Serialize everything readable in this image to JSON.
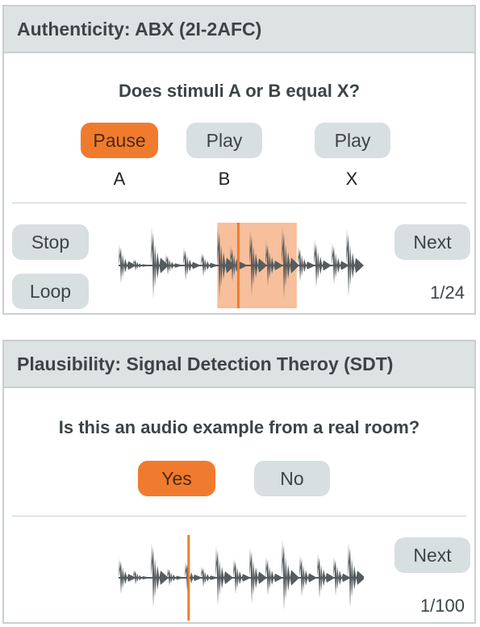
{
  "abx": {
    "title": "Authenticity: ABX (2I-2AFC)",
    "question": "Does stimuli A or B equal X?",
    "stimuli": [
      {
        "button_label": "Pause",
        "stimulus_label": "A",
        "active": true
      },
      {
        "button_label": "Play",
        "stimulus_label": "B",
        "active": false
      },
      {
        "button_label": "Play",
        "stimulus_label": "X",
        "active": false
      }
    ],
    "stop_label": "Stop",
    "loop_label": "Loop",
    "next_label": "Next",
    "counter": "1/24",
    "playhead_fraction": 0.49,
    "loop_region_fraction": [
      0.41,
      0.73
    ]
  },
  "sdt": {
    "title": "Plausibility: Signal Detection Theroy (SDT)",
    "question": "Is this an audio example from a real room?",
    "yes_label": "Yes",
    "no_label": "No",
    "next_label": "Next",
    "counter": "1/100",
    "playhead_fraction": 0.29
  },
  "colors": {
    "accent": "#f07b2e",
    "accent_region": "#f6b489",
    "button": "#d8dfe0",
    "header": "#dde2e3",
    "waveform": "#555b5e"
  }
}
